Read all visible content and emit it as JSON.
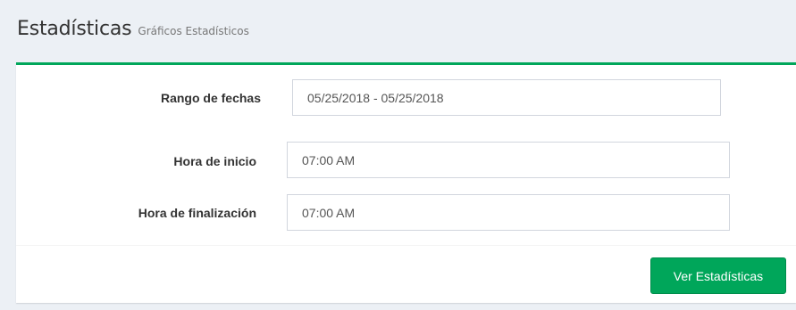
{
  "header": {
    "title": "Estadísticas",
    "subtitle": "Gráficos Estadísticos"
  },
  "form": {
    "date_range": {
      "label": "Rango de fechas",
      "value": "05/25/2018 - 05/25/2018"
    },
    "start_time": {
      "label": "Hora de inicio",
      "value": "07:00 AM"
    },
    "end_time": {
      "label": "Hora de finalización",
      "value": "07:00 AM"
    }
  },
  "footer": {
    "submit_label": "Ver Estadísticas"
  },
  "colors": {
    "accent": "#00a65a",
    "background": "#ecf0f5"
  }
}
